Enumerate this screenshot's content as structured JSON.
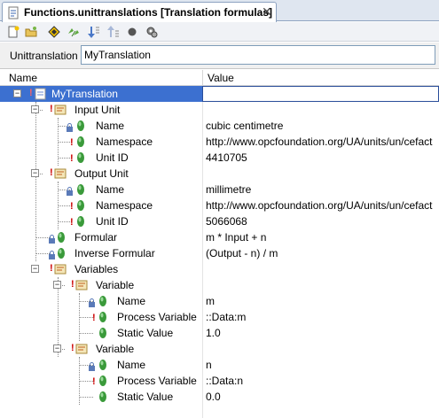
{
  "window": {
    "tab_title": "Functions.unittranslations [Translation formulas]",
    "close_glyph": "✕"
  },
  "toolbar": {
    "icons": [
      "new-icon",
      "folder-icon",
      "diamond-icon",
      "pair-icon",
      "move-down-icon",
      "move-up-icon",
      "record-icon",
      "settings-icon"
    ]
  },
  "unittranslation": {
    "label": "Unittranslation",
    "value": "MyTranslation"
  },
  "columns": {
    "name": "Name",
    "value": "Value"
  },
  "tree": {
    "root": {
      "name": "MyTranslation",
      "value": ""
    },
    "input_unit": {
      "name": "Input Unit"
    },
    "input_unit_name": {
      "name": "Name",
      "value": "cubic centimetre"
    },
    "input_unit_namespace": {
      "name": "Namespace",
      "value": "http://www.opcfoundation.org/UA/units/un/cefact"
    },
    "input_unit_id": {
      "name": "Unit ID",
      "value": "4410705"
    },
    "output_unit": {
      "name": "Output Unit"
    },
    "output_unit_name": {
      "name": "Name",
      "value": "millimetre"
    },
    "output_unit_namespace": {
      "name": "Namespace",
      "value": "http://www.opcfoundation.org/UA/units/un/cefact"
    },
    "output_unit_id": {
      "name": "Unit ID",
      "value": "5066068"
    },
    "formular": {
      "name": "Formular",
      "value": "m * Input + n"
    },
    "inverse_formular": {
      "name": "Inverse Formular",
      "value": "(Output - n) / m"
    },
    "variables": {
      "name": "Variables"
    },
    "variable1": {
      "name": "Variable"
    },
    "variable1_name": {
      "name": "Name",
      "value": "m"
    },
    "variable1_process": {
      "name": "Process Variable",
      "value": "::Data:m"
    },
    "variable1_static": {
      "name": "Static Value",
      "value": "1.0"
    },
    "variable2": {
      "name": "Variable"
    },
    "variable2_name": {
      "name": "Name",
      "value": "n"
    },
    "variable2_process": {
      "name": "Process Variable",
      "value": "::Data:n"
    },
    "variable2_static": {
      "name": "Static Value",
      "value": "0.0"
    }
  },
  "colors": {
    "selection": "#3c70d0",
    "required_marker": "#cc0000",
    "leaf_icon": "#3a9a3a"
  }
}
